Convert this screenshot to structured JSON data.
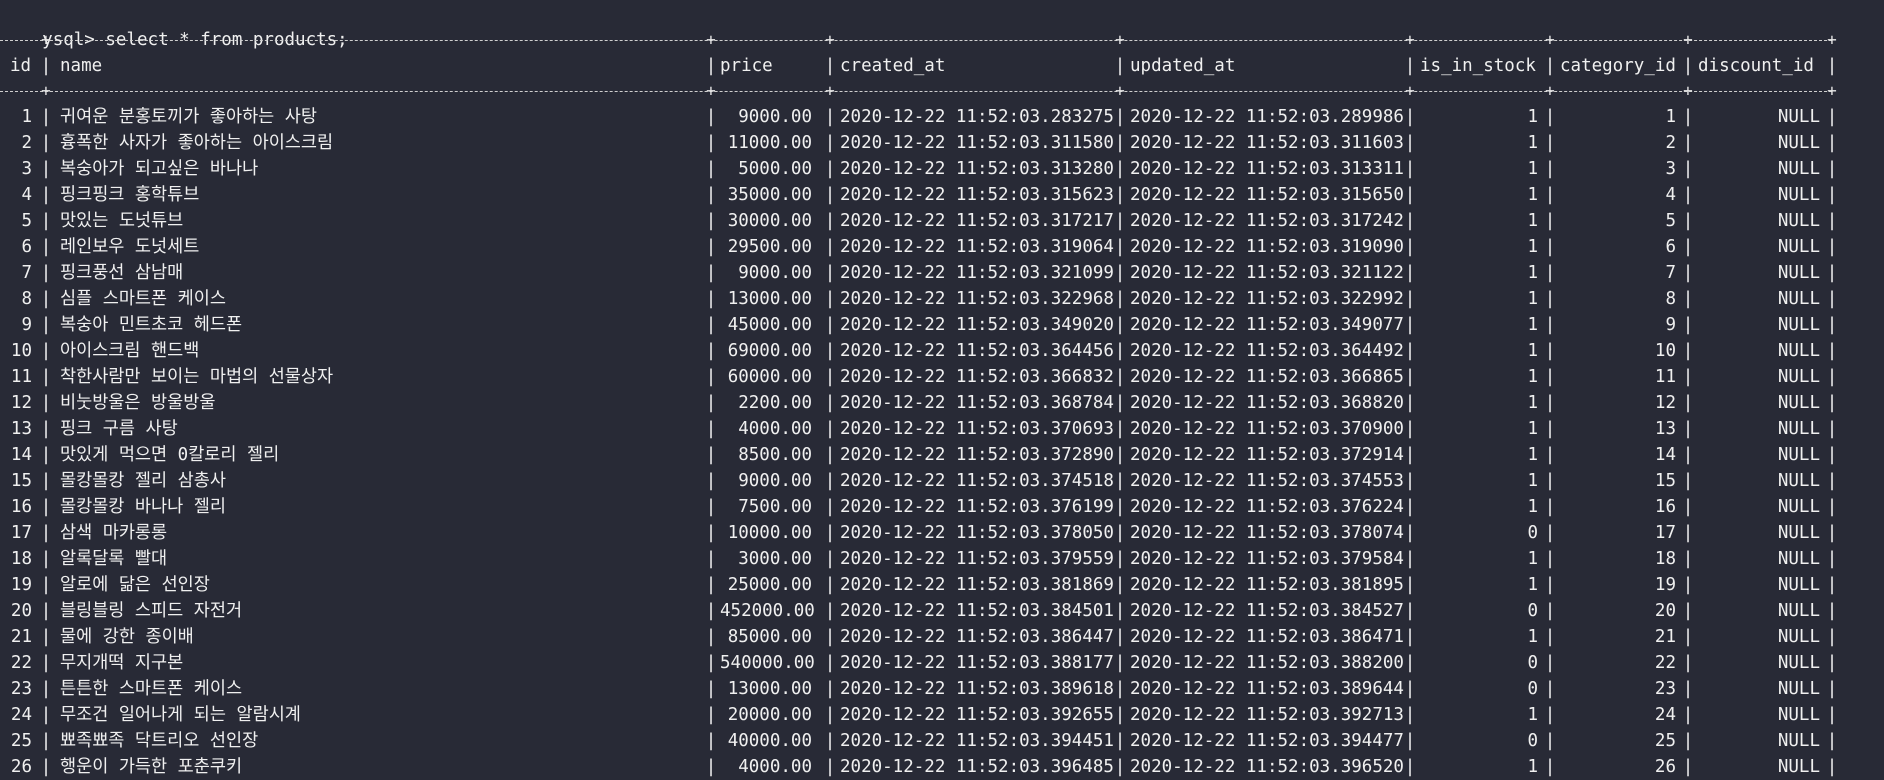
{
  "terminal": {
    "prompt": "ysql>",
    "command": "select * from products;"
  },
  "table": {
    "columns": [
      "id",
      "name",
      "price",
      "created_at",
      "updated_at",
      "is_in_stock",
      "category_id",
      "discount_id"
    ],
    "rows": [
      [
        "1",
        "귀여운 분홍토끼가 좋아하는 사탕",
        "9000.00",
        "2020-12-22 11:52:03.283275",
        "2020-12-22 11:52:03.289986",
        "1",
        "1",
        "NULL"
      ],
      [
        "2",
        "흉폭한 사자가 좋아하는 아이스크림",
        "11000.00",
        "2020-12-22 11:52:03.311580",
        "2020-12-22 11:52:03.311603",
        "1",
        "2",
        "NULL"
      ],
      [
        "3",
        "복숭아가 되고싶은 바나나",
        "5000.00",
        "2020-12-22 11:52:03.313280",
        "2020-12-22 11:52:03.313311",
        "1",
        "3",
        "NULL"
      ],
      [
        "4",
        "핑크핑크 홍학튜브",
        "35000.00",
        "2020-12-22 11:52:03.315623",
        "2020-12-22 11:52:03.315650",
        "1",
        "4",
        "NULL"
      ],
      [
        "5",
        "맛있는 도넛튜브",
        "30000.00",
        "2020-12-22 11:52:03.317217",
        "2020-12-22 11:52:03.317242",
        "1",
        "5",
        "NULL"
      ],
      [
        "6",
        "레인보우 도넛세트",
        "29500.00",
        "2020-12-22 11:52:03.319064",
        "2020-12-22 11:52:03.319090",
        "1",
        "6",
        "NULL"
      ],
      [
        "7",
        "핑크풍선 삼남매",
        "9000.00",
        "2020-12-22 11:52:03.321099",
        "2020-12-22 11:52:03.321122",
        "1",
        "7",
        "NULL"
      ],
      [
        "8",
        "심플 스마트폰 케이스",
        "13000.00",
        "2020-12-22 11:52:03.322968",
        "2020-12-22 11:52:03.322992",
        "1",
        "8",
        "NULL"
      ],
      [
        "9",
        "복숭아 민트초코 헤드폰",
        "45000.00",
        "2020-12-22 11:52:03.349020",
        "2020-12-22 11:52:03.349077",
        "1",
        "9",
        "NULL"
      ],
      [
        "10",
        "아이스크림 핸드백",
        "69000.00",
        "2020-12-22 11:52:03.364456",
        "2020-12-22 11:52:03.364492",
        "1",
        "10",
        "NULL"
      ],
      [
        "11",
        "착한사람만 보이는 마법의 선물상자",
        "60000.00",
        "2020-12-22 11:52:03.366832",
        "2020-12-22 11:52:03.366865",
        "1",
        "11",
        "NULL"
      ],
      [
        "12",
        "비눗방울은 방울방울",
        "2200.00",
        "2020-12-22 11:52:03.368784",
        "2020-12-22 11:52:03.368820",
        "1",
        "12",
        "NULL"
      ],
      [
        "13",
        "핑크 구름 사탕",
        "4000.00",
        "2020-12-22 11:52:03.370693",
        "2020-12-22 11:52:03.370900",
        "1",
        "13",
        "NULL"
      ],
      [
        "14",
        "맛있게 먹으면 0칼로리 젤리",
        "8500.00",
        "2020-12-22 11:52:03.372890",
        "2020-12-22 11:52:03.372914",
        "1",
        "14",
        "NULL"
      ],
      [
        "15",
        "몰캉몰캉 젤리 삼총사",
        "9000.00",
        "2020-12-22 11:52:03.374518",
        "2020-12-22 11:52:03.374553",
        "1",
        "15",
        "NULL"
      ],
      [
        "16",
        "몰캉몰캉 바나나 젤리",
        "7500.00",
        "2020-12-22 11:52:03.376199",
        "2020-12-22 11:52:03.376224",
        "1",
        "16",
        "NULL"
      ],
      [
        "17",
        "삼색 마카롱롱",
        "10000.00",
        "2020-12-22 11:52:03.378050",
        "2020-12-22 11:52:03.378074",
        "0",
        "17",
        "NULL"
      ],
      [
        "18",
        "알록달록 빨대",
        "3000.00",
        "2020-12-22 11:52:03.379559",
        "2020-12-22 11:52:03.379584",
        "1",
        "18",
        "NULL"
      ],
      [
        "19",
        "알로에 닮은 선인장",
        "25000.00",
        "2020-12-22 11:52:03.381869",
        "2020-12-22 11:52:03.381895",
        "1",
        "19",
        "NULL"
      ],
      [
        "20",
        "블링블링 스피드 자전거",
        "452000.00",
        "2020-12-22 11:52:03.384501",
        "2020-12-22 11:52:03.384527",
        "0",
        "20",
        "NULL"
      ],
      [
        "21",
        "물에 강한 종이배",
        "85000.00",
        "2020-12-22 11:52:03.386447",
        "2020-12-22 11:52:03.386471",
        "1",
        "21",
        "NULL"
      ],
      [
        "22",
        "무지개떡 지구본",
        "540000.00",
        "2020-12-22 11:52:03.388177",
        "2020-12-22 11:52:03.388200",
        "0",
        "22",
        "NULL"
      ],
      [
        "23",
        "튼튼한 스마트폰 케이스",
        "13000.00",
        "2020-12-22 11:52:03.389618",
        "2020-12-22 11:52:03.389644",
        "0",
        "23",
        "NULL"
      ],
      [
        "24",
        "무조건 일어나게 되는 알람시계",
        "20000.00",
        "2020-12-22 11:52:03.392655",
        "2020-12-22 11:52:03.392713",
        "1",
        "24",
        "NULL"
      ],
      [
        "25",
        "뾰족뾰족 닥트리오 선인장",
        "40000.00",
        "2020-12-22 11:52:03.394451",
        "2020-12-22 11:52:03.394477",
        "0",
        "25",
        "NULL"
      ],
      [
        "26",
        "행운이 가득한 포춘쿠키",
        "4000.00",
        "2020-12-22 11:52:03.396485",
        "2020-12-22 11:52:03.396520",
        "1",
        "26",
        "NULL"
      ]
    ]
  }
}
